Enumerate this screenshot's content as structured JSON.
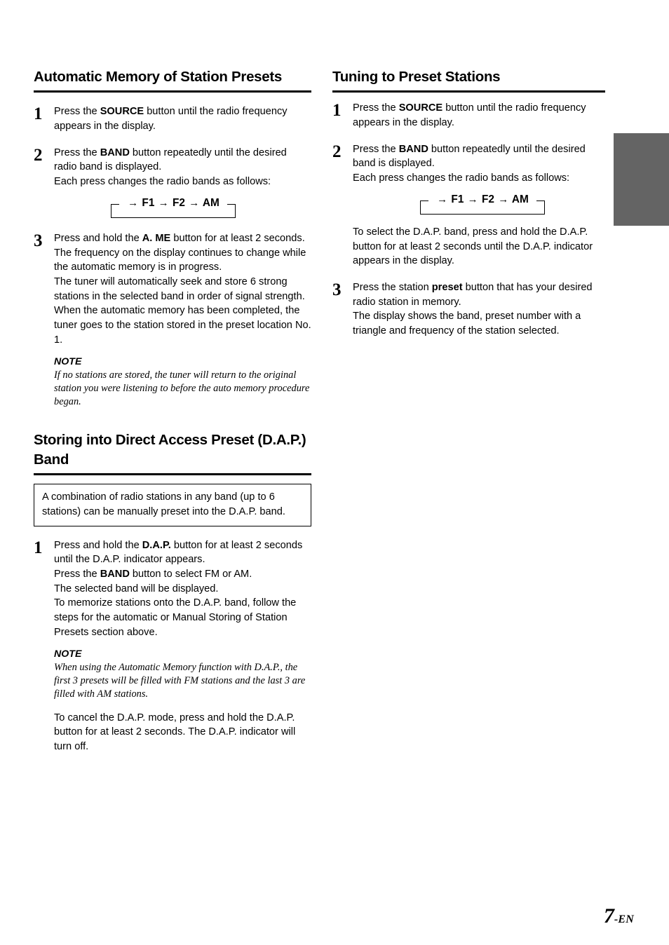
{
  "page": {
    "number": "7",
    "number_suffix": "-EN"
  },
  "left_column": {
    "section1": {
      "heading": "Automatic Memory of Station Presets",
      "steps": [
        {
          "number": "1",
          "lines": [
            {
              "segments": [
                {
                  "t": "Press the ",
                  "b": false
                },
                {
                  "t": "SOURCE",
                  "b": true
                },
                {
                  "t": " button until the radio frequency appears in the display.",
                  "b": false
                }
              ]
            }
          ]
        },
        {
          "number": "2",
          "lines": [
            {
              "segments": [
                {
                  "t": "Press the ",
                  "b": false
                },
                {
                  "t": "BAND",
                  "b": true
                },
                {
                  "t": " button repeatedly until the desired radio band is displayed.",
                  "b": false
                }
              ]
            },
            {
              "segments": [
                {
                  "t": "Each press changes the radio bands as follows:",
                  "b": false
                }
              ]
            }
          ]
        },
        {
          "number": "3",
          "lines": [
            {
              "segments": [
                {
                  "t": "Press and hold the ",
                  "b": false
                },
                {
                  "t": "A. ME",
                  "b": true
                },
                {
                  "t": " button for at least 2 seconds.",
                  "b": false
                }
              ]
            },
            {
              "segments": [
                {
                  "t": "The frequency on the display continues to change while the automatic memory is in progress.",
                  "b": false
                }
              ]
            },
            {
              "segments": [
                {
                  "t": "The tuner will automatically seek and store 6 strong stations in the selected band in order of signal strength.",
                  "b": false
                }
              ]
            },
            {
              "segments": [
                {
                  "t": "When the automatic memory has been completed, the tuner goes to the station stored in the preset location No. 1.",
                  "b": false
                }
              ]
            }
          ]
        }
      ],
      "band_loop": {
        "arrow": "→",
        "bands": [
          "F1",
          "F2",
          "AM"
        ]
      },
      "note": {
        "label": "NOTE",
        "text": "If no stations are stored, the tuner will return to the original station you were listening to before the auto memory procedure began."
      }
    },
    "section2": {
      "heading": "Storing into Direct Access Preset (D.A.P.) Band",
      "callout": "A combination of radio stations in any band (up to 6 stations) can be manually preset into the D.A.P. band.",
      "step1": {
        "number": "1",
        "lines": [
          {
            "segments": [
              {
                "t": "Press and hold the ",
                "b": false
              },
              {
                "t": "D.A.P.",
                "b": true
              },
              {
                "t": " button for at least 2 seconds until the D.A.P. indicator appears.",
                "b": false
              }
            ]
          },
          {
            "segments": [
              {
                "t": "Press the ",
                "b": false
              },
              {
                "t": "BAND",
                "b": true
              },
              {
                "t": " button to select FM or AM.",
                "b": false
              }
            ]
          },
          {
            "segments": [
              {
                "t": "The selected band will be displayed.",
                "b": false
              }
            ]
          },
          {
            "segments": [
              {
                "t": "To memorize stations onto the D.A.P. band, follow the steps for the automatic or Manual Storing of Station Presets section above.",
                "b": false
              }
            ]
          }
        ]
      },
      "note": {
        "label": "NOTE",
        "text": "When using the Automatic Memory function with D.A.P., the first 3 presets will be filled with FM stations and the last 3 are filled with AM stations."
      },
      "closing": "To cancel the D.A.P. mode, press and hold the D.A.P. button for at least 2 seconds. The D.A.P. indicator will turn off."
    }
  },
  "right_column": {
    "section1": {
      "heading": "Tuning to Preset Stations",
      "steps": [
        {
          "number": "1",
          "lines": [
            {
              "segments": [
                {
                  "t": "Press the ",
                  "b": false
                },
                {
                  "t": "SOURCE",
                  "b": true
                },
                {
                  "t": " button until the radio frequency appears in the display.",
                  "b": false
                }
              ]
            }
          ]
        },
        {
          "number": "2",
          "lines": [
            {
              "segments": [
                {
                  "t": "Press the ",
                  "b": false
                },
                {
                  "t": "BAND",
                  "b": true
                },
                {
                  "t": " button repeatedly until the desired band is displayed.",
                  "b": false
                }
              ]
            },
            {
              "segments": [
                {
                  "t": "Each press changes the radio bands as follows:",
                  "b": false
                }
              ]
            }
          ]
        },
        {
          "number": "3",
          "lines": [
            {
              "segments": [
                {
                  "t": "Press the station ",
                  "b": false
                },
                {
                  "t": "preset",
                  "b": true
                },
                {
                  "t": " button that has your desired radio station in memory.",
                  "b": false
                }
              ]
            },
            {
              "segments": [
                {
                  "t": "The display shows the band, preset number with a triangle and frequency of the station selected.",
                  "b": false
                }
              ]
            }
          ]
        }
      ],
      "band_loop": {
        "arrow": "→",
        "bands": [
          "F1",
          "F2",
          "AM"
        ]
      },
      "dap_note": "To select the D.A.P. band, press and hold the D.A.P. button for at least 2 seconds until the D.A.P. indicator appears in the display."
    }
  }
}
